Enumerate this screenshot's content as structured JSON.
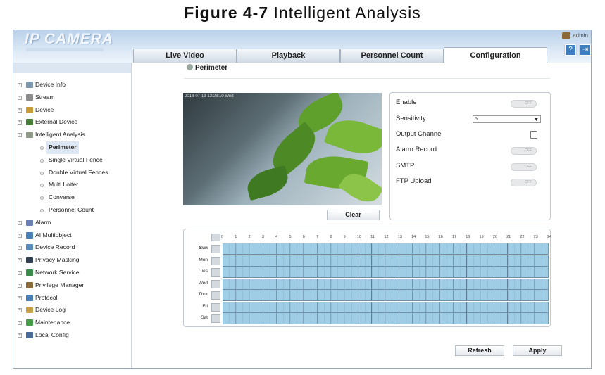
{
  "caption": {
    "label": "Figure 4-7",
    "text": " Intelligent Analysis"
  },
  "app": {
    "logo": "IP CAMERA",
    "user": "admin"
  },
  "tabs": [
    {
      "label": "Live Video"
    },
    {
      "label": "Playback"
    },
    {
      "label": "Personnel Count"
    },
    {
      "label": "Configuration",
      "active": true
    }
  ],
  "sidebar": {
    "items": [
      {
        "label": "Device Info",
        "icon": "info-icon",
        "color": "#7f97ad"
      },
      {
        "label": "Stream",
        "icon": "stream-icon",
        "color": "#8a8a8a"
      },
      {
        "label": "Device",
        "icon": "device-icon",
        "color": "#c99a3a"
      },
      {
        "label": "External Device",
        "icon": "external-device-icon",
        "color": "#4a7f3a"
      },
      {
        "label": "Intelligent Analysis",
        "icon": "intelligent-analysis-icon",
        "color": "#8f9a88"
      },
      {
        "label": "Perimeter",
        "sub": true,
        "selected": true
      },
      {
        "label": "Single Virtual Fence",
        "sub": true
      },
      {
        "label": "Double Virtual Fences",
        "sub": true
      },
      {
        "label": "Multi Loiter",
        "sub": true
      },
      {
        "label": "Converse",
        "sub": true
      },
      {
        "label": "Personnel Count",
        "sub": true
      },
      {
        "label": "Alarm",
        "icon": "alarm-icon",
        "color": "#6a7fb5"
      },
      {
        "label": "AI Multiobject",
        "icon": "ai-multiobject-icon",
        "color": "#4a7fb5"
      },
      {
        "label": "Device Record",
        "icon": "device-record-icon",
        "color": "#5a8aba"
      },
      {
        "label": "Privacy Masking",
        "icon": "privacy-masking-icon",
        "color": "#2f3f4f"
      },
      {
        "label": "Network Service",
        "icon": "network-service-icon",
        "color": "#3a8a4a"
      },
      {
        "label": "Privilege Manager",
        "icon": "privilege-manager-icon",
        "color": "#8a6a3a"
      },
      {
        "label": "Protocol",
        "icon": "protocol-icon",
        "color": "#4a7fb5"
      },
      {
        "label": "Device Log",
        "icon": "device-log-icon",
        "color": "#c9a04a"
      },
      {
        "label": "Maintenance",
        "icon": "maintenance-icon",
        "color": "#4a9a4a"
      },
      {
        "label": "Local Config",
        "icon": "local-config-icon",
        "color": "#4a6a9a"
      }
    ]
  },
  "page": {
    "title": "Perimeter"
  },
  "video": {
    "timestamp": "2018-07-13 12:23:10 Wed"
  },
  "settings": {
    "enable_label": "Enable",
    "enable_state": "OFF",
    "sensitivity_label": "Sensitivity",
    "sensitivity_value": "5",
    "output_channel_label": "Output Channel",
    "alarm_record_label": "Alarm Record",
    "alarm_record_state": "OFF",
    "smtp_label": "SMTP",
    "smtp_state": "OFF",
    "ftp_label": "FTP Upload",
    "ftp_state": "OFF"
  },
  "buttons": {
    "clear": "Clear",
    "refresh": "Refresh",
    "apply": "Apply"
  },
  "schedule": {
    "hours": [
      "0",
      "1",
      "2",
      "3",
      "4",
      "5",
      "6",
      "7",
      "8",
      "9",
      "10",
      "11",
      "12",
      "13",
      "14",
      "15",
      "16",
      "17",
      "18",
      "19",
      "20",
      "21",
      "22",
      "23",
      "24"
    ],
    "days": [
      "Sun",
      "Mon",
      "Tues",
      "Wed",
      "Thur",
      "Fri",
      "Sat"
    ],
    "selected_day": "Sun"
  }
}
